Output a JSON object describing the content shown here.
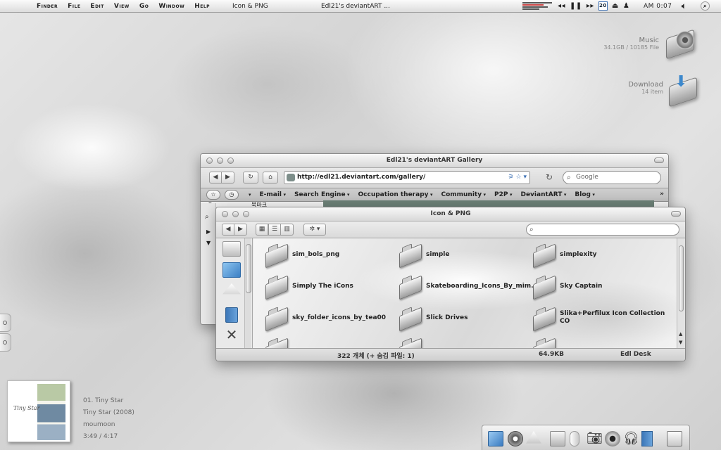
{
  "menubar": {
    "menus": [
      "Finder",
      "File",
      "Edit",
      "View",
      "Go",
      "Window",
      "Help"
    ],
    "app_title": "Icon & PNG",
    "window_title": "Edl21's deviantART ...",
    "calendar_day": "20",
    "clock": "AM 0:07"
  },
  "drives": [
    {
      "name": "Music",
      "meta": "34.1GB / 10185 File"
    },
    {
      "name": "Download",
      "meta": "14  item"
    }
  ],
  "now_playing": {
    "track": "01. Tiny Star",
    "album": "Tiny Star (2008)",
    "artist": "moumoon",
    "time": "3:49 / 4:17",
    "cover_text": "Tiny Star"
  },
  "safari": {
    "title": "Edl21's deviantART Gallery",
    "url": "http://edl21.deviantart.com/gallery/",
    "search_placeholder": "Google",
    "bookmarks": [
      "E-mail",
      "Search Engine",
      "Occupation therapy",
      "Community",
      "P2P",
      "DeviantART",
      "Blog"
    ],
    "tab_label": "북마크"
  },
  "finder": {
    "title": "Icon & PNG",
    "items": [
      "sim_bols_png",
      "simple",
      "simplexity",
      "Simply The iCons",
      "Skateboarding_Icons_By_mim...",
      "Sky Captain",
      "sky_folder_icons_by_tea00",
      "Slick Drives",
      "Slika+Perfilux Icon Collection CO"
    ],
    "status_count": "322 개체 (+ 숨김 파일: 1)",
    "status_size": "64.9KB",
    "status_name": "Edl Desk"
  },
  "colors": {
    "accent_blue": "#3b6fb4",
    "bookmark_green": "#6b7f76"
  }
}
